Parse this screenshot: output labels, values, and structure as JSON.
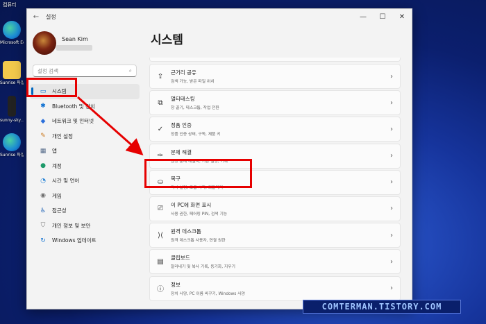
{
  "desktop": {
    "top_label": "컴퓨터",
    "icons": [
      {
        "label": "Microsoft Edge",
        "color": "#1b8bd8"
      },
      {
        "label": "Sunrise 파일 공유",
        "color": "#f2c94c"
      },
      {
        "label": "sunny-sky...",
        "color": "#222222"
      },
      {
        "label": "Sunrise 파일 공유",
        "color": "#1b8bd8"
      }
    ]
  },
  "window": {
    "title": "설정",
    "back_icon": "←",
    "minimize": "—",
    "maximize": "☐",
    "close": "✕"
  },
  "profile": {
    "name": "Sean Kim"
  },
  "search": {
    "placeholder": "설정 검색",
    "icon": "⌕"
  },
  "nav": [
    {
      "label": "시스템",
      "icon": "▭",
      "icon_color": "#0a6ed1",
      "active": true
    },
    {
      "label": "Bluetooth 및 장치",
      "icon": "✱",
      "icon_color": "#0a6ed1"
    },
    {
      "label": "네트워크 및 인터넷",
      "icon": "◆",
      "icon_color": "#2a6fdb"
    },
    {
      "label": "개인 설정",
      "icon": "✎",
      "icon_color": "#c9761a"
    },
    {
      "label": "앱",
      "icon": "▦",
      "icon_color": "#556b8a"
    },
    {
      "label": "계정",
      "icon": "●",
      "icon_color": "#1e9a6a"
    },
    {
      "label": "시간 및 언어",
      "icon": "◔",
      "icon_color": "#1f7fd6"
    },
    {
      "label": "게임",
      "icon": "◉",
      "icon_color": "#6d6d6d"
    },
    {
      "label": "접근성",
      "icon": "♿",
      "icon_color": "#1a5fb4"
    },
    {
      "label": "개인 정보 및 보안",
      "icon": "⛉",
      "icon_color": "#777777"
    },
    {
      "label": "Windows 업데이트",
      "icon": "↻",
      "icon_color": "#0a6ed1"
    }
  ],
  "main": {
    "title": "시스템",
    "cards": [
      {
        "title": "근거리 공유",
        "subtitle": "검색 가능, 받은 파일 위치",
        "icon": "⇪",
        "icon_name": "nearby-share-icon"
      },
      {
        "title": "멀티태스킹",
        "subtitle": "창 끌기, 데스크톱, 작업 전환",
        "icon": "⧉",
        "icon_name": "multitasking-icon"
      },
      {
        "title": "정품 인증",
        "subtitle": "정품 인증 상태, 구독, 제품 키",
        "icon": "✓",
        "icon_name": "activation-icon"
      },
      {
        "title": "문제 해결",
        "subtitle": "권장 문제 해결사, 기본 설정, 기록",
        "icon": "✑",
        "icon_name": "troubleshoot-icon"
      },
      {
        "title": "복구",
        "subtitle": "다시 설정, 고급 시작, 되돌리기",
        "icon": "⛀",
        "icon_name": "recovery-icon"
      },
      {
        "title": "이 PC에 화면 표시",
        "subtitle": "사용 권한, 페어링 PIN, 검색 기능",
        "icon": "⎚",
        "icon_name": "project-to-pc-icon"
      },
      {
        "title": "원격 데스크톱",
        "subtitle": "원격 데스크톱 사용자, 연결 권한",
        "icon": "⟩⟨",
        "icon_name": "remote-desktop-icon"
      },
      {
        "title": "클립보드",
        "subtitle": "잘라내기 및 복사 기록, 동기화, 지우기",
        "icon": "▤",
        "icon_name": "clipboard-icon"
      },
      {
        "title": "정보",
        "subtitle": "장치 사양, PC 이름 바꾸기, Windows 사양",
        "icon": "ⓘ",
        "icon_name": "about-icon"
      }
    ]
  },
  "watermark": "COMTERMAN.TISTORY.COM",
  "highlight_color": "#e60000"
}
